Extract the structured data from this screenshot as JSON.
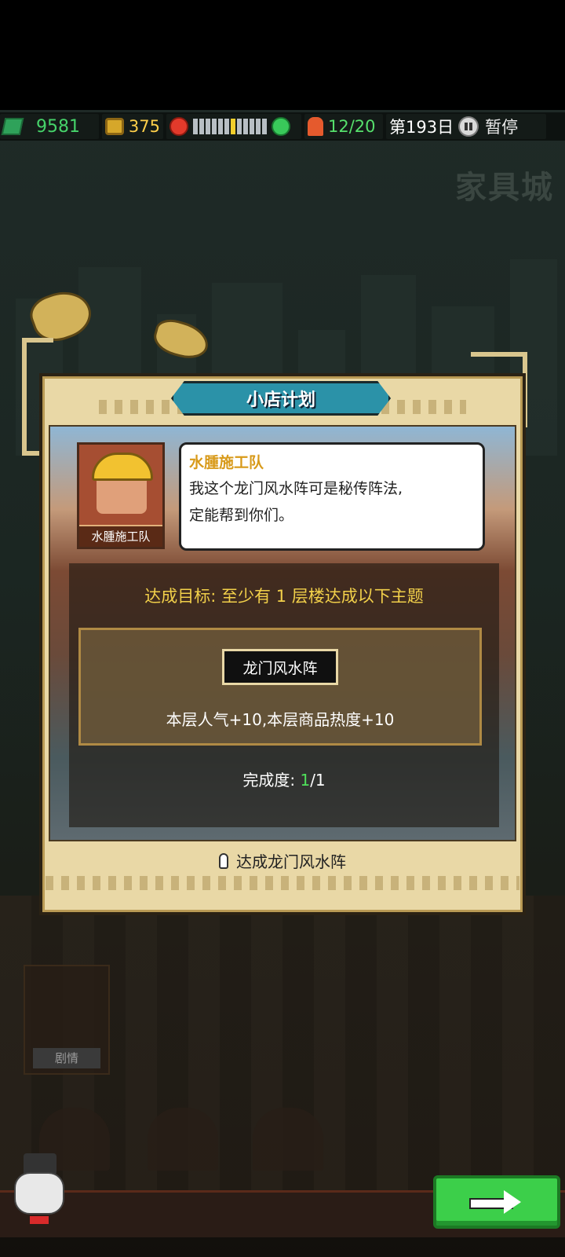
{
  "status_bar": {
    "cash": "9581",
    "coins": "375",
    "mood": {
      "segments_total": 12,
      "active_segment": 7
    },
    "staff": "12/20",
    "day": "第193日",
    "pause_label": "暂停"
  },
  "floor_title": "家具城",
  "dialog": {
    "title": "小店计划",
    "npc": {
      "portrait_label": "水腫施工队",
      "speaker": "水腫施工队",
      "line1": "我这个龙门风水阵可是秘传阵法,",
      "line2": "定能帮到你们。"
    },
    "goal": "达成目标: 至少有 1 层楼达成以下主题",
    "theme": {
      "name": "龙门风水阵",
      "effect": "本层人气+10,本层商品热度+10"
    },
    "progress": {
      "label": "完成度: ",
      "done": "1",
      "total": "/1"
    },
    "footer_hint": "达成龙门风水阵"
  },
  "bottom": {
    "story_label": "剧情"
  },
  "colors": {
    "cash": "#46d36a",
    "coins": "#ffd04a",
    "goal": "#f2d04a",
    "banner": "#2b92a8",
    "go_button": "#3ccf4a"
  },
  "icons": [
    "cash-icon",
    "coin-icon",
    "angry-face-icon",
    "happy-face-icon",
    "staff-icon",
    "pause-icon",
    "bulb-icon",
    "arrow-right-icon"
  ]
}
